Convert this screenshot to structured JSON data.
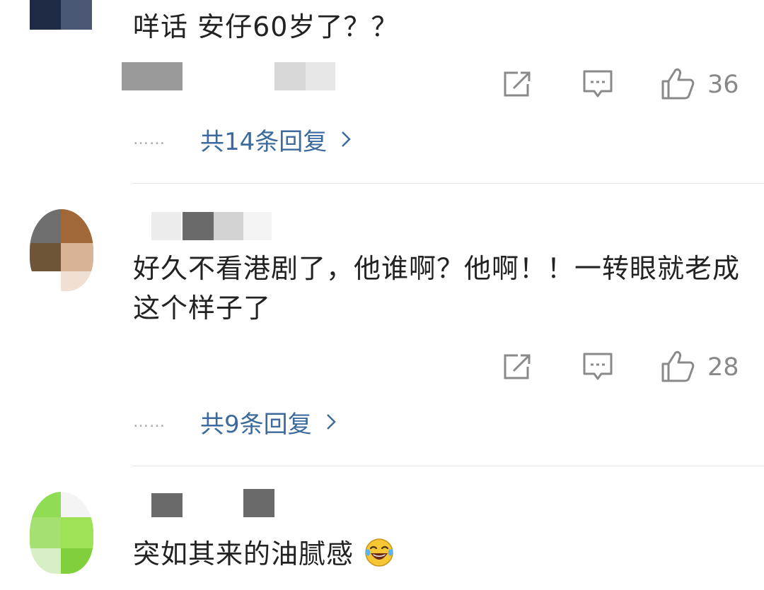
{
  "comments": [
    {
      "text": "咩话 安仔60岁了？？",
      "likes": "36",
      "replies": "共14条回复"
    },
    {
      "text": "好久不看港剧了，他谁啊？他啊！！一转眼就老成这个样子了",
      "likes": "28",
      "replies": "共9条回复"
    },
    {
      "text": "突如其来的油腻感",
      "emoji": "laughing-tears-emoji"
    }
  ],
  "reply_prefix_dots": "……",
  "icons": {
    "share": "share-icon",
    "comment": "comment-icon",
    "like": "thumbs-up-icon",
    "chevron": "chevron-right-icon"
  },
  "colors": {
    "reply_link": "#3d6a9c",
    "icon_gray": "#8a8a8a",
    "divider": "#e6e6e6"
  }
}
